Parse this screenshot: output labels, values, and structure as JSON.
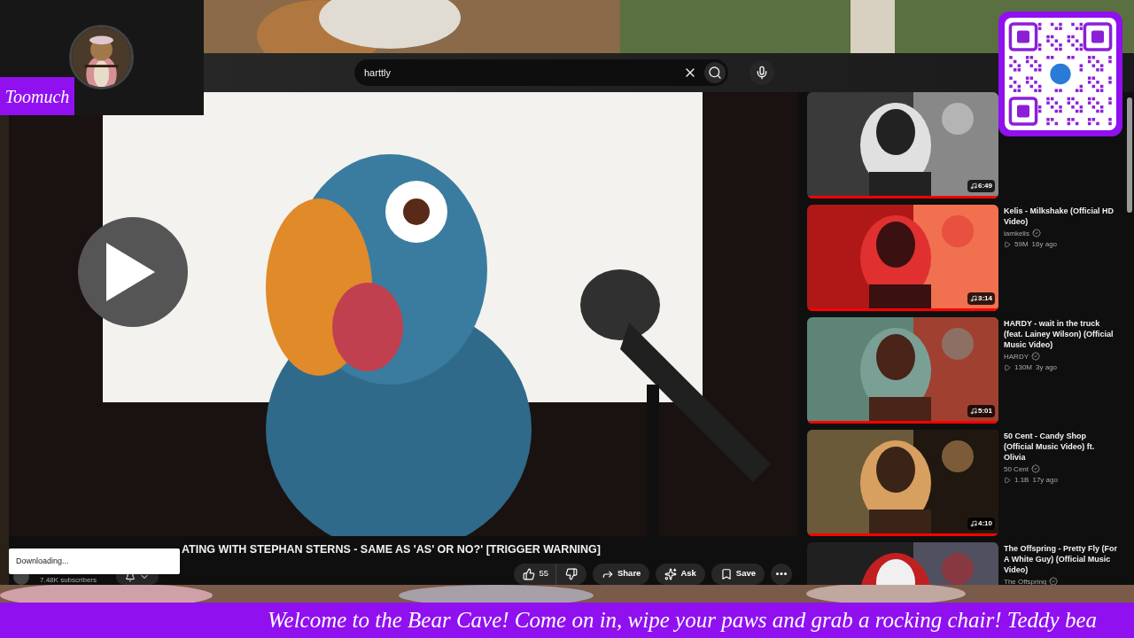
{
  "overlay": {
    "streamer_name": "Toomuch",
    "banner_text": "Welcome to the Bear Cave! Come on in, wipe your paws and grab a rocking chair! Teddy bea"
  },
  "search": {
    "value": "harttly"
  },
  "video": {
    "title": "ATING WITH STEPHAN STERNS - SAME AS 'AS' OR NO?' [TRIGGER WARNING]",
    "subscribers": "7.48K subscribers",
    "likes": "55",
    "actions": [
      {
        "kind": "share",
        "label": "Share"
      },
      {
        "kind": "ask",
        "label": "Ask"
      },
      {
        "kind": "save",
        "label": "Save"
      }
    ]
  },
  "toast": "Downloading...",
  "recommendations": [
    {
      "duration": "6:49",
      "level": 1
    },
    {
      "title": "Kelis - Milkshake (Official HD Video)",
      "channel": "iamkelis",
      "views": "59M",
      "age": "16y ago",
      "duration": "3:14",
      "level": 1
    },
    {
      "title": "HARDY - wait in the truck (feat. Lainey Wilson) (Official Music Video)",
      "channel": "HARDY",
      "views": "130M",
      "age": "3y ago",
      "duration": "5:01",
      "level": 1
    },
    {
      "title": "50 Cent - Candy Shop (Official Music Video) ft. Olivia",
      "channel": "50 Cent",
      "views": "1.1B",
      "age": "17y ago",
      "duration": "4:10",
      "level": 1
    },
    {
      "title": "The Offspring - Pretty Fly (For A White Guy) (Official Music Video)",
      "channel": "The Offspring"
    }
  ]
}
